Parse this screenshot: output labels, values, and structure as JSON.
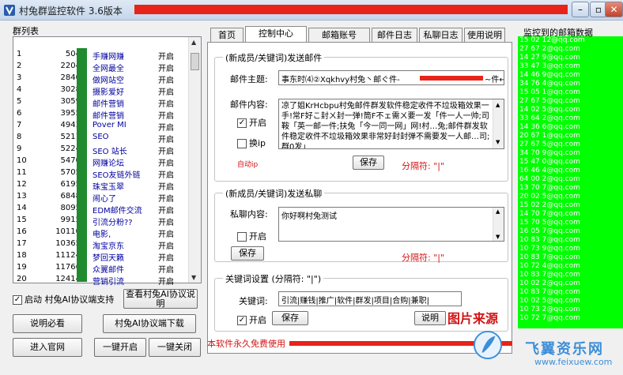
{
  "window": {
    "title": "村兔群监控软件 3.6版本",
    "min": "–",
    "max": "▫",
    "close": "✕"
  },
  "left": {
    "list_label": "群列表",
    "groups": [
      {
        "i": "1",
        "n": "504",
        "name": "手赚网赚",
        "s": "开启"
      },
      {
        "i": "2",
        "n": "2204",
        "name": "全网最全",
        "s": "开启"
      },
      {
        "i": "3",
        "n": "2840",
        "name": "做网站空",
        "s": "开启"
      },
      {
        "i": "4",
        "n": "3028",
        "name": "摄影爱好",
        "s": "开启"
      },
      {
        "i": "5",
        "n": "3059",
        "name": "邮件营销",
        "s": "开启"
      },
      {
        "i": "6",
        "n": "3955",
        "name": "邮件营销",
        "s": "开启"
      },
      {
        "i": "7",
        "n": "4943",
        "name": "Pover MI",
        "s": "开启"
      },
      {
        "i": "8",
        "n": "5211",
        "name": "SEO",
        "s": "开启"
      },
      {
        "i": "9",
        "n": "5224",
        "name": "SEO 站长",
        "s": "开启"
      },
      {
        "i": "10",
        "n": "5470",
        "name": "网赚论坛",
        "s": "开启"
      },
      {
        "i": "11",
        "n": "5705",
        "name": "SEO友链外链",
        "s": "开启"
      },
      {
        "i": "12",
        "n": "6195",
        "name": "珠宝玉翠",
        "s": "开启"
      },
      {
        "i": "13",
        "n": "6848",
        "name": "闹心了",
        "s": "开启"
      },
      {
        "i": "14",
        "n": "8095",
        "name": "EDM邮件交流",
        "s": "开启"
      },
      {
        "i": "15",
        "n": "9915",
        "name": "引流分粉??",
        "s": "开启"
      },
      {
        "i": "16",
        "n": "10110",
        "name": "电影,",
        "s": "开启"
      },
      {
        "i": "17",
        "n": "10365",
        "name": "淘宝京东",
        "s": "开启"
      },
      {
        "i": "18",
        "n": "11124",
        "name": "梦回天籁",
        "s": "开启"
      },
      {
        "i": "19",
        "n": "11766",
        "name": "众翼邮件",
        "s": "开启"
      },
      {
        "i": "20",
        "n": "12414",
        "name": "营销引流",
        "s": "开启"
      }
    ],
    "chk_start": "启动 村兔AI协议端支持",
    "btn_view": "查看村兔AI协议说明",
    "btn_notice": "说明必看",
    "btn_download": "村兔AI协议端下载",
    "btn_join": "进入官网",
    "btn_all_on": "一键开启",
    "btn_all_off": "一键关闭"
  },
  "tabs": [
    "首页",
    "控制中心",
    "邮箱账号",
    "邮件日志",
    "私聊日志",
    "使用说明"
  ],
  "email": {
    "group_title": "(新成员/关键词)发送邮件",
    "subject_label": "邮件主题:",
    "subject_value": "事东时⑷②Xqkhvy村兔丶邮ぐ件-",
    "subject_tail": "~件←",
    "body_label": "邮件内容:",
    "body_text": "凉了姐KrHcbpu村兔邮件群发软件稳定收件不垃圾箱效果一手!常F好こ封ㄨ封一弹!筒F不ェ需ㄨ要一发「件一人一帅;司鞍「英一邮一件;扶兔「今一同一网」网!村…兔;邮件群发软件稳定收件不垃圾箱效果非常好封封弹不需要发一人邮…司;群0发」",
    "chk_enable": "开启",
    "chk_change": "换ip",
    "ip_note": "自动ip",
    "save": "保存",
    "separator_note": "分隔符: \"|\""
  },
  "pm": {
    "group_title": "(新成员/关键词)发送私聊",
    "content_label": "私聊内容:",
    "content_value": "你好啊村兔测试",
    "chk_enable": "开启",
    "save": "保存",
    "separator_note": "分隔符: \"|\""
  },
  "keywords": {
    "group_title": "关键词设置 (分隔符: \"|\")",
    "label": "关键词:",
    "value": "引流|赚钱|推广|软件|群发|项目|合购|兼职|",
    "chk_enable": "开启",
    "save": "保存",
    "help": "说明"
  },
  "right": {
    "label": "监控到的邮箱数据",
    "emails": [
      "15 02 12@qq.com",
      "27 67 2@qq.com",
      "14 27 9@qq.com",
      "33 47 3@qq.com",
      "14 46 9@qq.com",
      "34 76 4@qq.com",
      "15 05 1@qq.com",
      "27 67 5@qq.com",
      "14 02 5@qq.com",
      "33 64 2@qq.com",
      "14 36 6@qq.com",
      "20 67 1@qq.com",
      "27 67 5@qq.com",
      "34 70 9@qq.com",
      "15 47 0@qq.com",
      "16 46 4@qq.com",
      "64 00 2@qq.com",
      "13 70 7@qq.com",
      "20 02 5@qq.com",
      "15 02 2@qq.com",
      "14 70 7@qq.com",
      "15 70 5@qq.com",
      "16 05 7@qq.com",
      "10 83 7@qq.com",
      "10 73 9@qq.com",
      "10 83 7@qq.com",
      "10 72 4@qq.com",
      "10 83 7@qq.com",
      "10 02 2@qq.com",
      "10 83 7@qq.com",
      "10 02 5@qq.com",
      "10 73 2@qq.com",
      "10 72 7@qq.com"
    ]
  },
  "footer": {
    "note": "本软件永久免费使用"
  },
  "watermark": {
    "source": "图片来源",
    "brand": "飞翼资乐网",
    "url": "www.feixuew.com"
  }
}
